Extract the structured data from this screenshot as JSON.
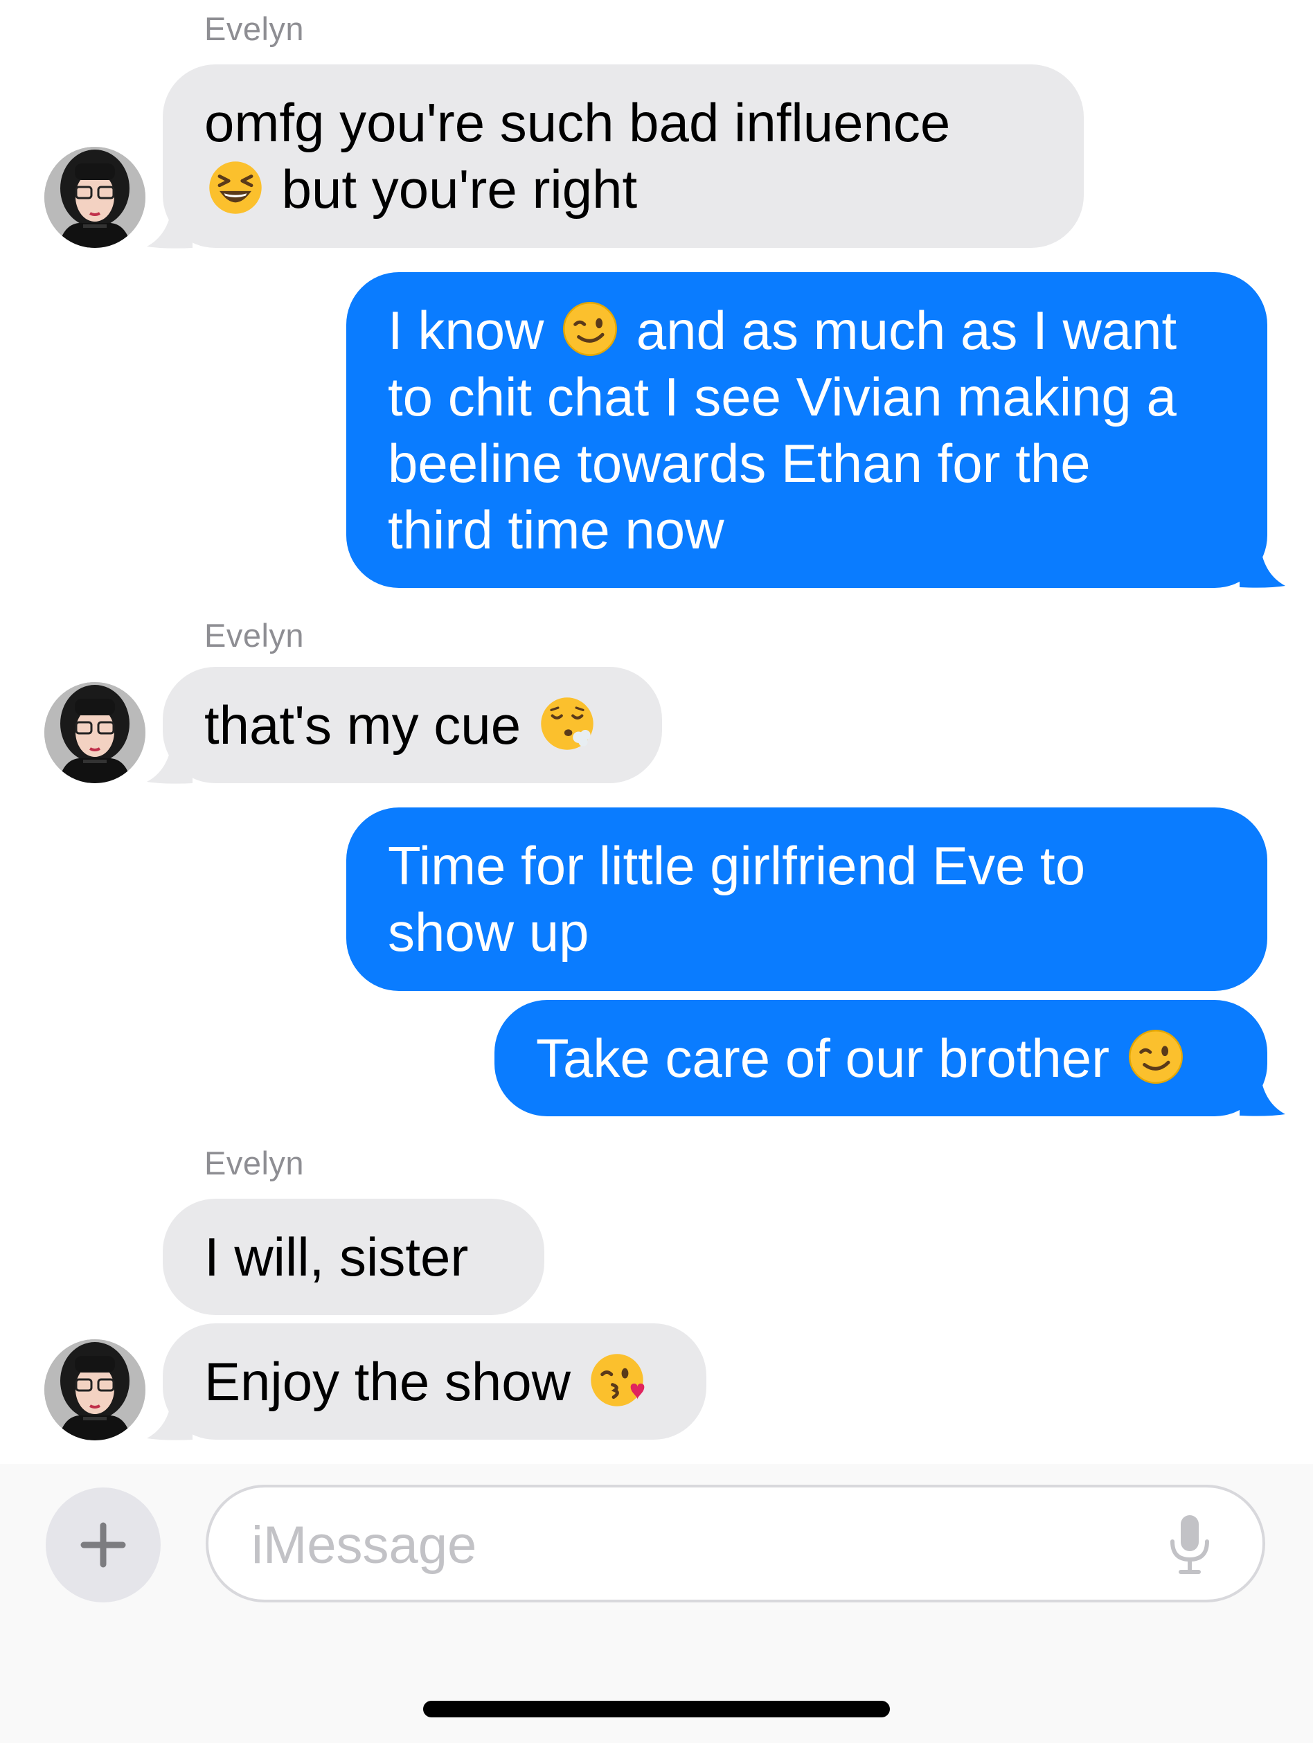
{
  "thread": {
    "groups": [
      {
        "sender": "Evelyn"
      },
      {
        "sender": "Evelyn"
      },
      {
        "sender": "Evelyn"
      }
    ],
    "messages": [
      {
        "from": "incoming",
        "lines": [
          "omfg you're such bad influence",
          "but you're right"
        ],
        "emoji": "laughing-squint-emoji"
      },
      {
        "from": "outgoing",
        "lines": [
          "I know",
          "and as much as I want",
          "to chit chat I see Vivian making a",
          "beeline towards Ethan for the",
          "third time now"
        ],
        "emoji": "winking-face-emoji"
      },
      {
        "from": "incoming",
        "lines": [
          "that's my cue"
        ],
        "emoji": "exhaling-face-emoji"
      },
      {
        "from": "outgoing",
        "lines": [
          "Time for little girlfriend Eve to",
          "show up"
        ]
      },
      {
        "from": "outgoing",
        "lines": [
          "Take care of our brother"
        ],
        "emoji": "winking-face-emoji"
      },
      {
        "from": "incoming",
        "lines": [
          "I will, sister"
        ]
      },
      {
        "from": "incoming",
        "lines": [
          "Enjoy the show"
        ],
        "emoji": "face-blowing-kiss-emoji"
      }
    ]
  },
  "composer": {
    "placeholder": "iMessage",
    "plus_icon": "plus-icon",
    "mic_icon": "microphone-icon"
  },
  "colors": {
    "incoming_bubble": "#e9e9eb",
    "outgoing_bubble": "#0a7cff",
    "sender_label": "#8e8e93",
    "placeholder": "#c2c2c6"
  }
}
